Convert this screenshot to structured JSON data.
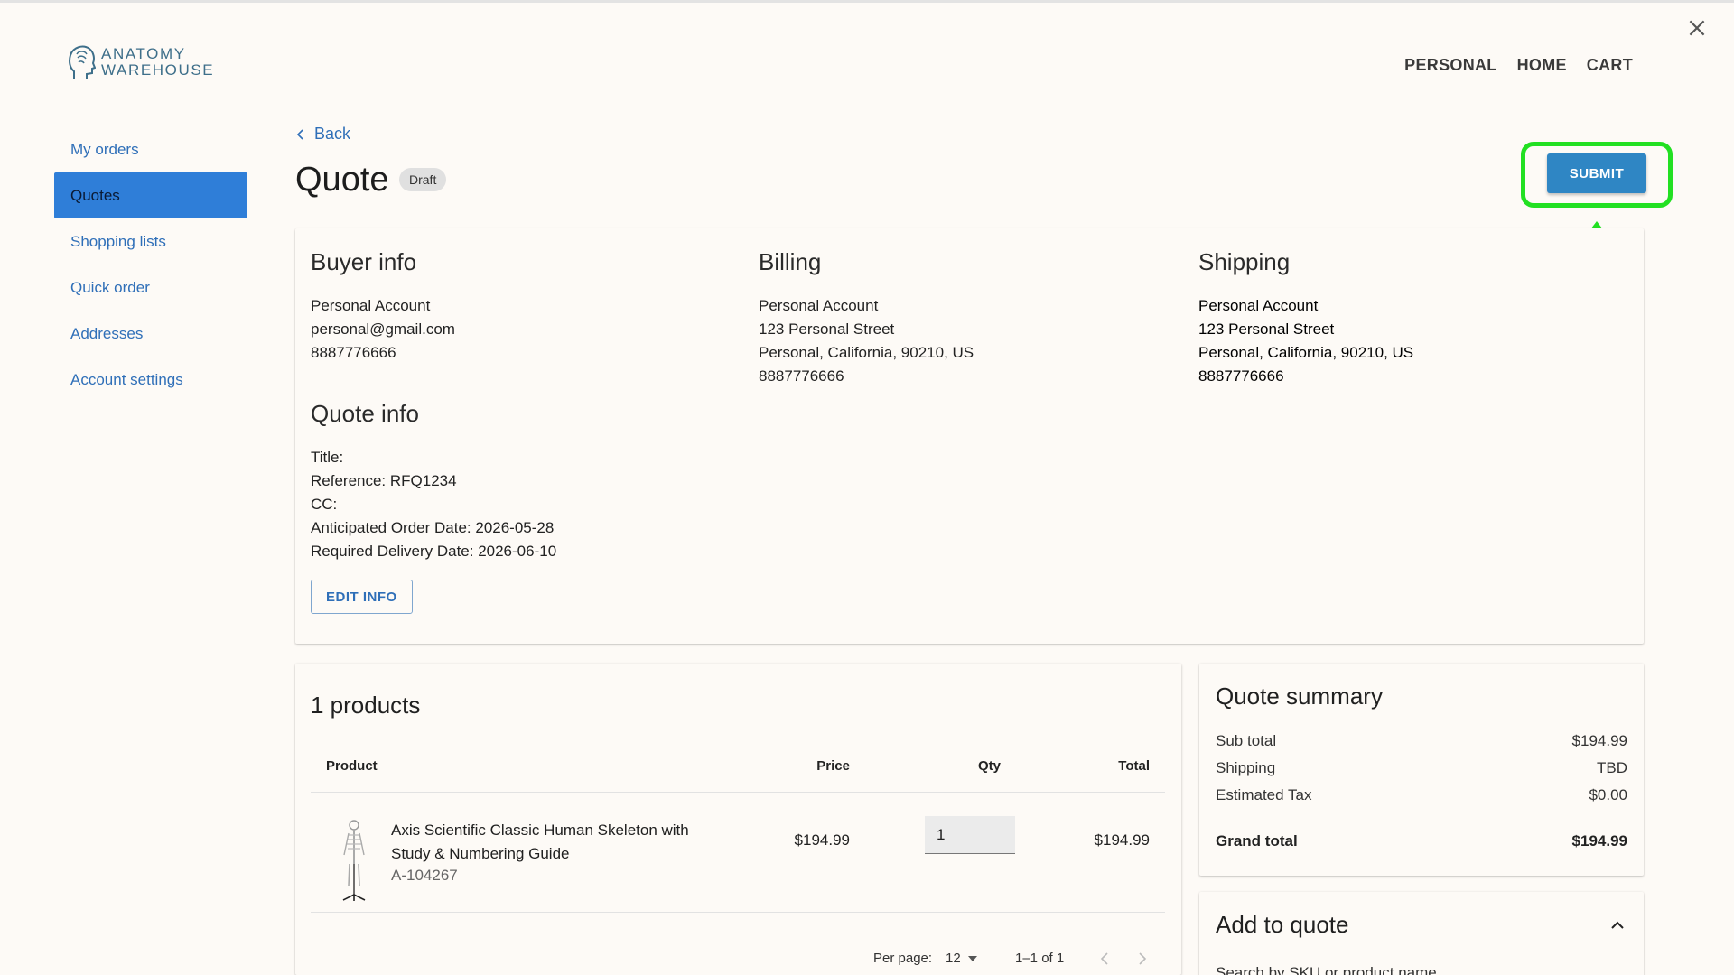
{
  "header": {
    "logo_line1": "ANATOMY",
    "logo_line2": "WAREHOUSE",
    "nav": [
      "PERSONAL",
      "HOME",
      "CART"
    ]
  },
  "sidebar": {
    "items": [
      {
        "label": "My orders",
        "active": false
      },
      {
        "label": "Quotes",
        "active": true
      },
      {
        "label": "Shopping lists",
        "active": false
      },
      {
        "label": "Quick order",
        "active": false
      },
      {
        "label": "Addresses",
        "active": false
      },
      {
        "label": "Account settings",
        "active": false
      }
    ]
  },
  "page": {
    "back_label": "Back",
    "title": "Quote",
    "status_badge": "Draft",
    "submit_label": "SUBMIT"
  },
  "buyer_info": {
    "heading": "Buyer info",
    "name": "Personal Account",
    "email": "personal@gmail.com",
    "phone": "8887776666"
  },
  "billing": {
    "heading": "Billing",
    "name": "Personal Account",
    "street": "123 Personal Street",
    "city_line": "Personal, California, 90210, US",
    "phone": "8887776666"
  },
  "shipping": {
    "heading": "Shipping",
    "name": "Personal Account",
    "street": "123 Personal Street",
    "city_line": "Personal, California, 90210, US",
    "phone": "8887776666"
  },
  "quote_info": {
    "heading": "Quote info",
    "title_line": "Title:",
    "reference_line": "Reference: RFQ1234",
    "cc_line": "CC:",
    "anticipated_line": "Anticipated Order Date: 2026-05-28",
    "required_line": "Required Delivery Date: 2026-06-10",
    "edit_label": "EDIT INFO"
  },
  "products": {
    "heading": "1 products",
    "columns": {
      "product": "Product",
      "price": "Price",
      "qty": "Qty",
      "total": "Total"
    },
    "rows": [
      {
        "name": "Axis Scientific Classic Human Skeleton with Study & Numbering Guide",
        "sku": "A-104267",
        "price": "$194.99",
        "qty": "1",
        "total": "$194.99"
      }
    ],
    "pagination": {
      "per_page_label": "Per page:",
      "per_page_value": "12",
      "range": "1–1 of 1"
    }
  },
  "summary": {
    "heading": "Quote summary",
    "subtotal_label": "Sub total",
    "subtotal_value": "$194.99",
    "shipping_label": "Shipping",
    "shipping_value": "TBD",
    "tax_label": "Estimated Tax",
    "tax_value": "$0.00",
    "grand_label": "Grand total",
    "grand_value": "$194.99"
  },
  "add_to_quote": {
    "heading": "Add to quote",
    "search_label": "Search by SKU or product name"
  },
  "colors": {
    "accent": "#2f7ed8",
    "submit": "#2f86c4",
    "highlight": "#22e022",
    "link": "#2f6fb8"
  }
}
